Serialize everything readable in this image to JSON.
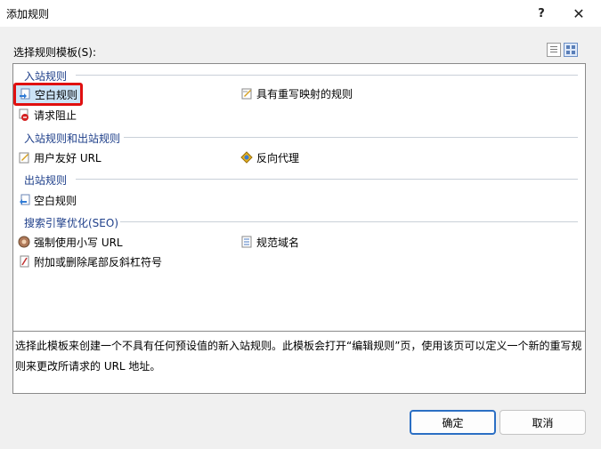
{
  "window": {
    "title": "添加规则",
    "help": "?",
    "close": "✕"
  },
  "prompt": "选择规则模板(S):",
  "groups": {
    "inbound": "入站规则",
    "both": "入站规则和出站规则",
    "outbound": "出站规则",
    "seo": "搜索引擎优化(SEO)"
  },
  "items": {
    "blank_inbound": "空白规则",
    "rewrite_map": "具有重写映射的规则",
    "request_block": "请求阻止",
    "friendly_url": "用户友好 URL",
    "reverse_proxy": "反向代理",
    "blank_outbound": "空白规则",
    "lowercase": "强制使用小写 URL",
    "canonical": "规范域名",
    "trailing_slash": "附加或删除尾部反斜杠符号"
  },
  "description_lines": [
    "选择此模板来创建一个不具有任何预设值的新入站规则。此模板会打开“编辑规则”页，使用该页可以定义一个新的重写规",
    "则来更改所请求的 URL 地址。"
  ],
  "buttons": {
    "ok": "确定",
    "cancel": "取消"
  },
  "colors": {
    "group_text": "#1e3f8a",
    "highlight": "#e01010",
    "selection": "#cce4f7"
  }
}
